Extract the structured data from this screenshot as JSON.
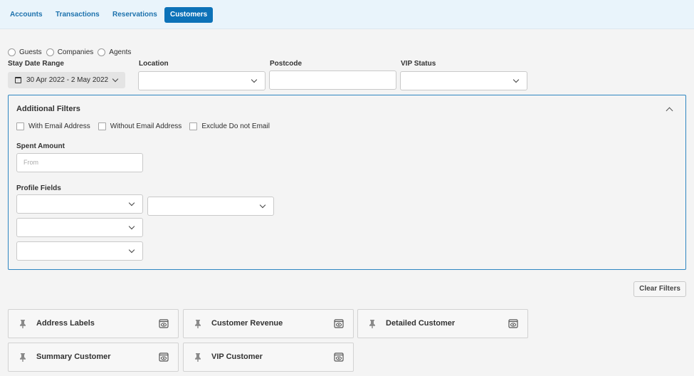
{
  "nav": {
    "tabs": [
      {
        "label": "Accounts"
      },
      {
        "label": "Transactions"
      },
      {
        "label": "Reservations"
      },
      {
        "label": "Customers",
        "active": true
      }
    ]
  },
  "customer_type": {
    "options": [
      "Guests",
      "Companies",
      "Agents"
    ]
  },
  "stay_date": {
    "label": "Stay Date Range",
    "value": "30 Apr 2022 - 2 May 2022"
  },
  "location": {
    "label": "Location",
    "value": ""
  },
  "postcode": {
    "label": "Postcode",
    "value": ""
  },
  "vip_status": {
    "label": "VIP Status",
    "value": ""
  },
  "additional_filters": {
    "title": "Additional Filters",
    "checkboxes": [
      "With Email Address",
      "Without Email Address",
      "Exclude Do not Email"
    ],
    "spent_amount": {
      "label": "Spent Amount",
      "placeholder": "From"
    },
    "profile_fields": {
      "label": "Profile Fields"
    }
  },
  "clear_filters_label": "Clear Filters",
  "report_cards": [
    "Address Labels",
    "Customer Revenue",
    "Detailed Customer",
    "Summary Customer",
    "VIP Customer"
  ],
  "colors": {
    "accent": "#0c72b8",
    "nav_bg": "#e9f4fb",
    "panel_border": "#2e86c1"
  }
}
